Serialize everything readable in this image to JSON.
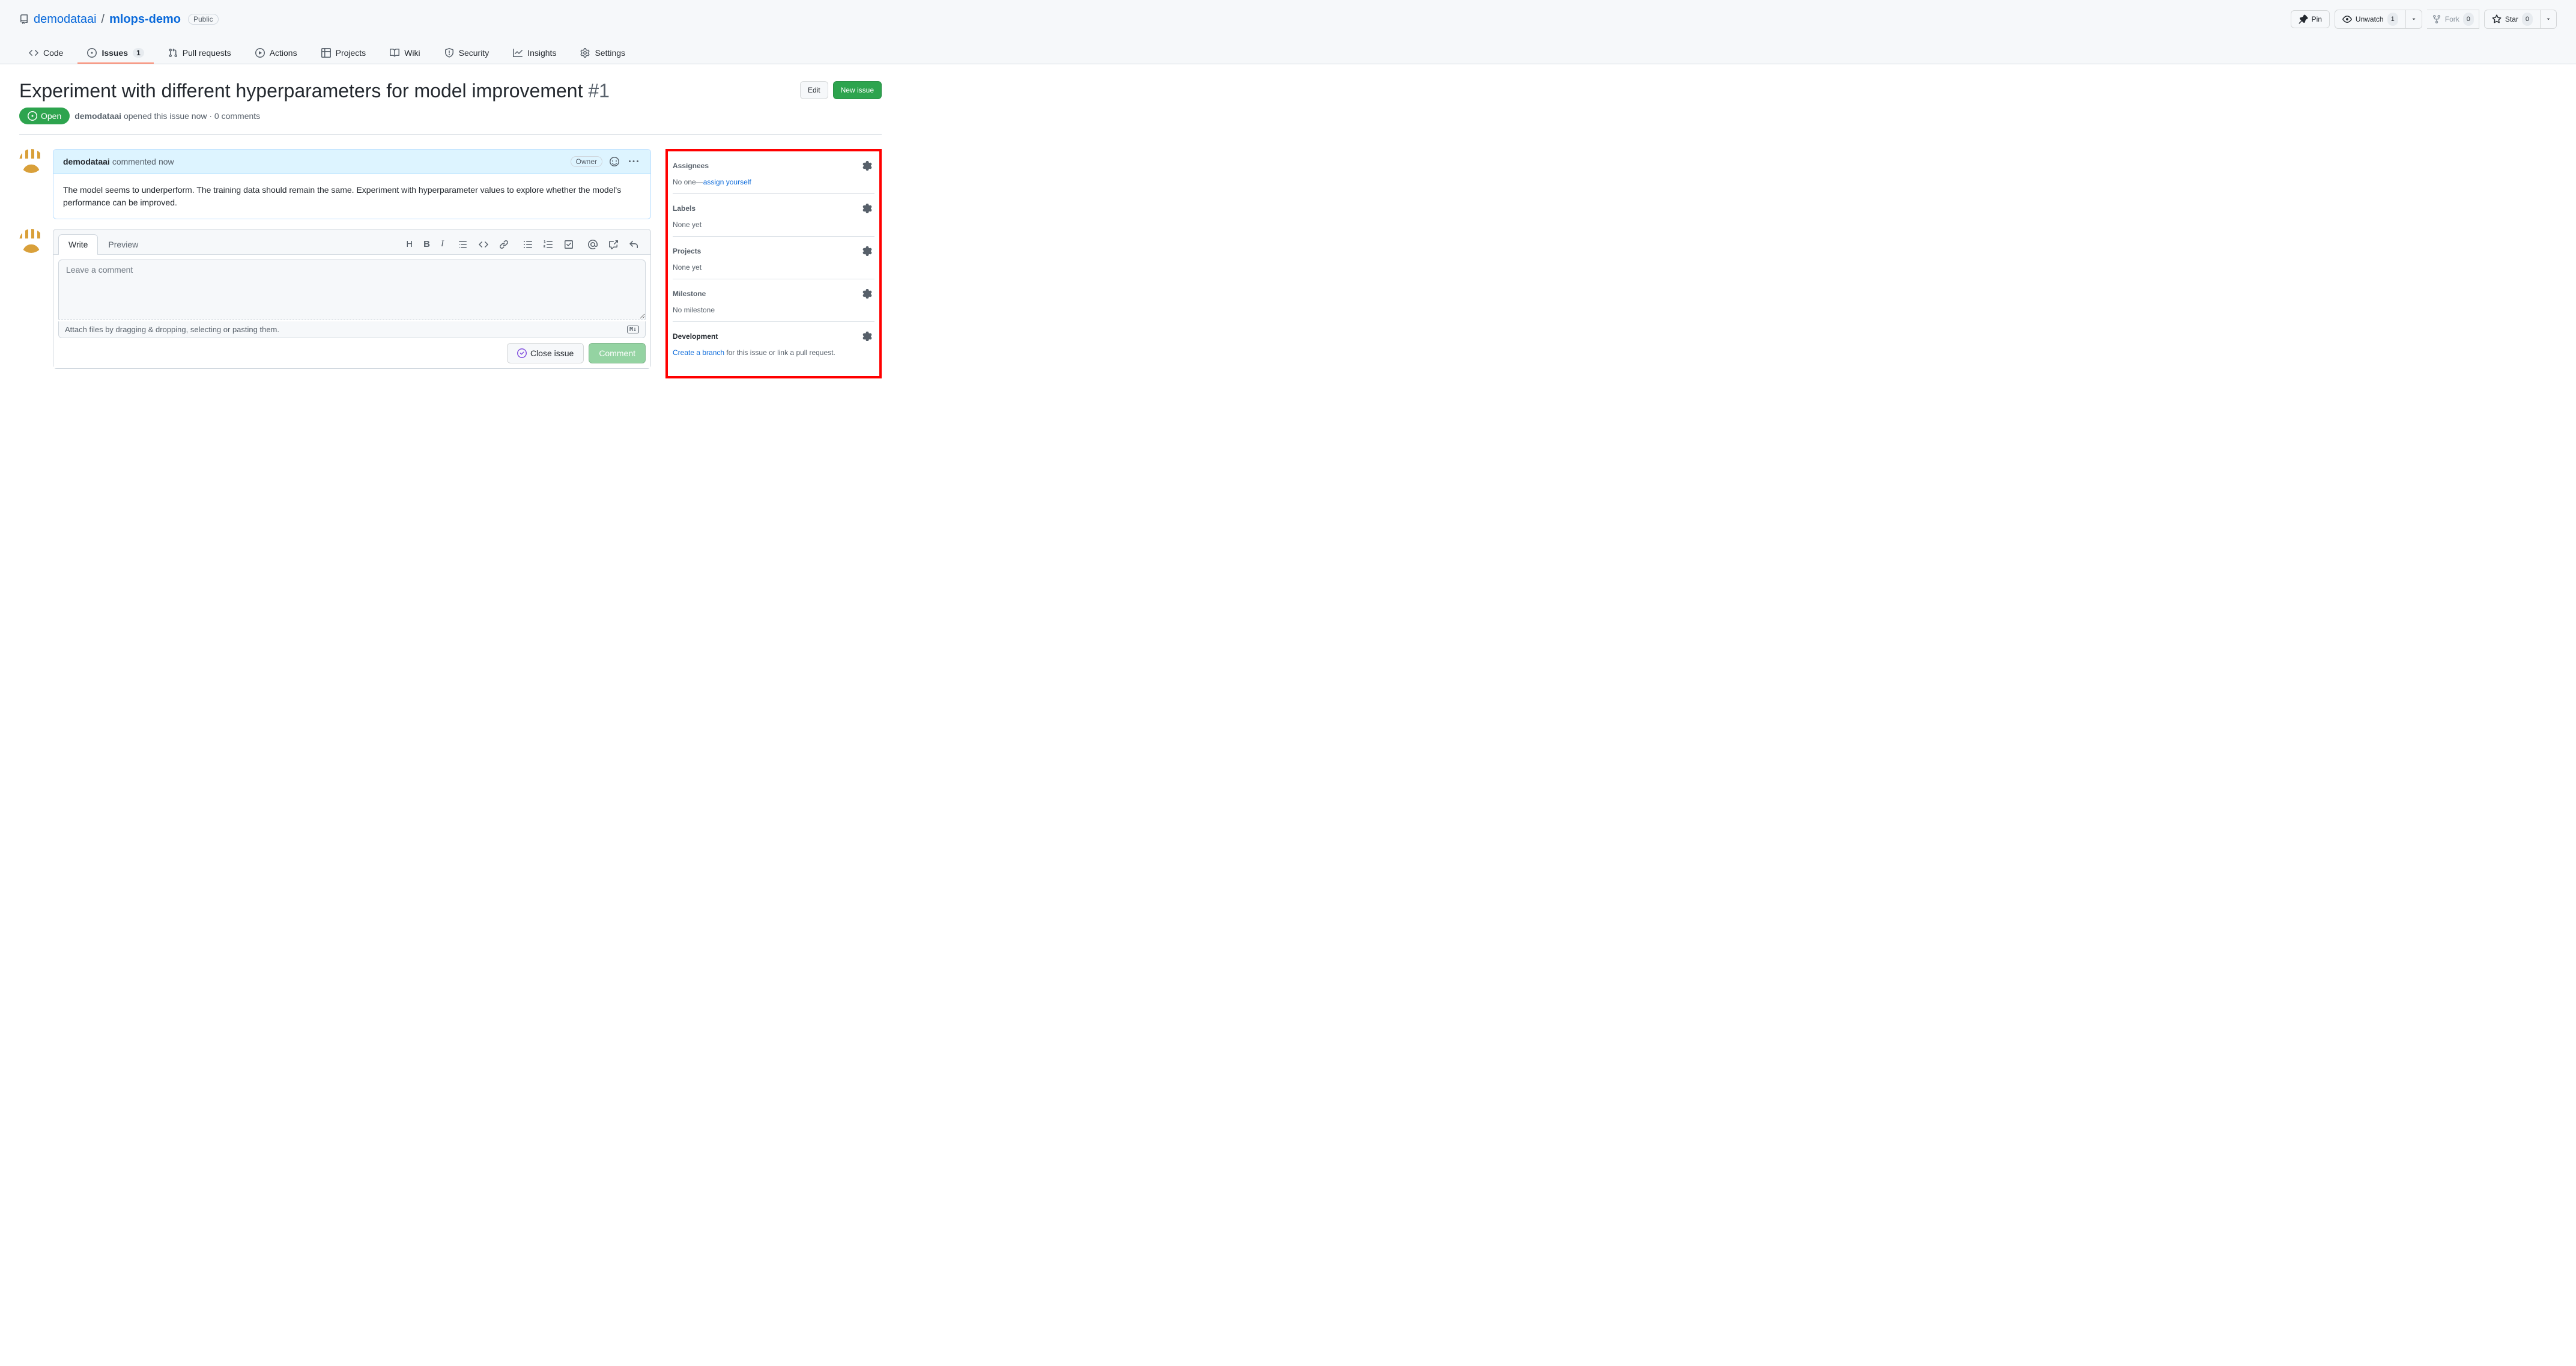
{
  "repo": {
    "owner": "demodataai",
    "name": "mlops-demo",
    "visibility": "Public"
  },
  "repoActions": {
    "pin": "Pin",
    "unwatch": "Unwatch",
    "unwatchCount": "1",
    "fork": "Fork",
    "forkCount": "0",
    "star": "Star",
    "starCount": "0"
  },
  "nav": {
    "code": "Code",
    "issues": "Issues",
    "issuesCount": "1",
    "pulls": "Pull requests",
    "actions": "Actions",
    "projects": "Projects",
    "wiki": "Wiki",
    "security": "Security",
    "insights": "Insights",
    "settings": "Settings"
  },
  "issue": {
    "title": "Experiment with different hyperparameters for model improvement",
    "number": "#1",
    "edit": "Edit",
    "newIssue": "New issue",
    "state": "Open",
    "metaAuthor": "demodataai",
    "metaRest": " opened this issue now · 0 comments"
  },
  "comment": {
    "author": "demodataai",
    "verb": "commented",
    "time": "now",
    "role": "Owner",
    "body": "The model seems to underperform. The training data should remain the same. Experiment with hyperparameter values to explore whether the model's performance can be improved."
  },
  "form": {
    "writeTab": "Write",
    "previewTab": "Preview",
    "placeholder": "Leave a comment",
    "attachHint": "Attach files by dragging & dropping, selecting or pasting them.",
    "mdBadge": "M↓",
    "closeIssue": "Close issue",
    "commentBtn": "Comment"
  },
  "sidebar": {
    "assignees": {
      "title": "Assignees",
      "body_prefix": "No one—",
      "link": "assign yourself"
    },
    "labels": {
      "title": "Labels",
      "body": "None yet"
    },
    "projects": {
      "title": "Projects",
      "body": "None yet"
    },
    "milestone": {
      "title": "Milestone",
      "body": "No milestone"
    },
    "development": {
      "title": "Development",
      "link": "Create a branch",
      "rest": " for this issue or link a pull request."
    }
  }
}
